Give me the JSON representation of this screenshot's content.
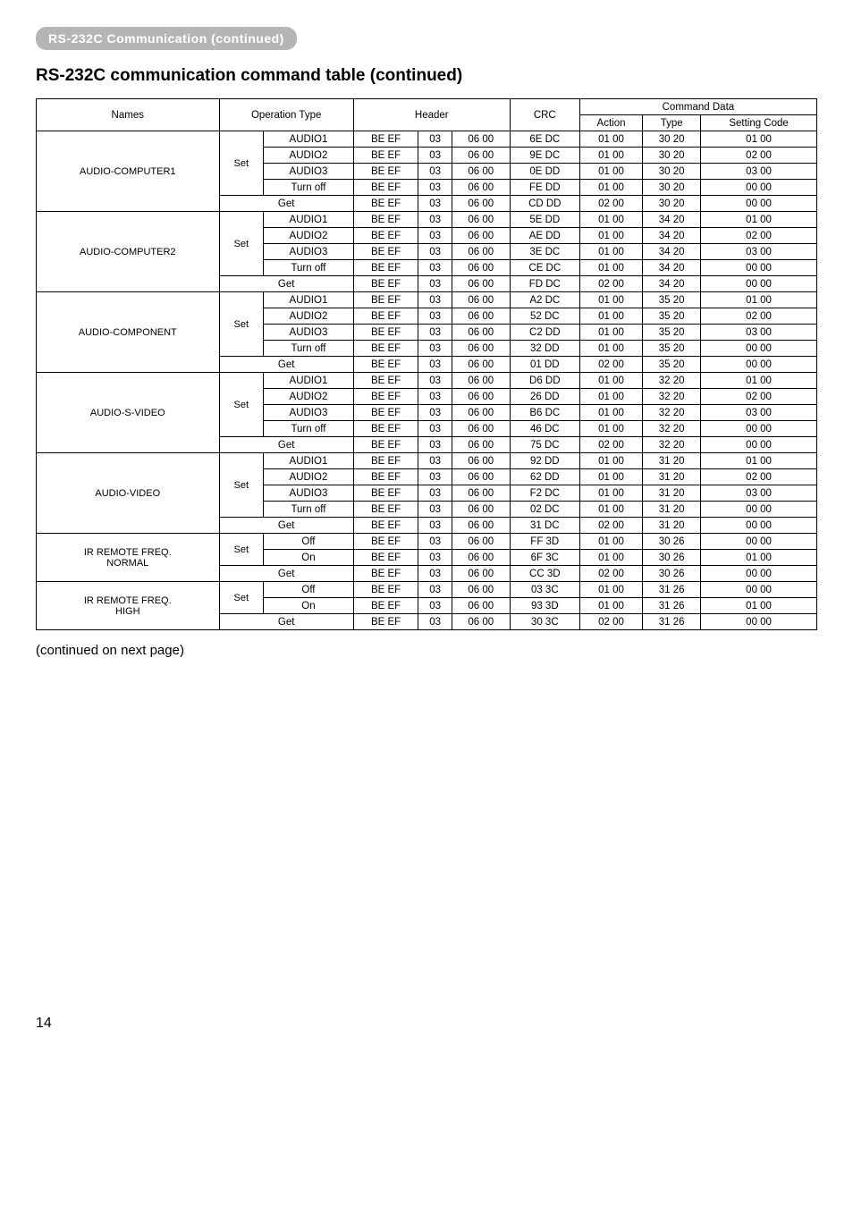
{
  "section_tab": "RS-232C Communication (continued)",
  "title": "RS-232C communication command table (continued)",
  "continued_note": "(continued on next page)",
  "page_num": "14",
  "headers": {
    "names": "Names",
    "operation_type": "Operation Type",
    "header": "Header",
    "crc": "CRC",
    "command_data": "Command Data",
    "action": "Action",
    "type": "Type",
    "setting_code": "Setting Code"
  },
  "groups": [
    {
      "name": "AUDIO-COMPUTER1",
      "set_label": "Set",
      "set_rows": [
        {
          "op": "AUDIO1",
          "h1": "BE  EF",
          "h2": "03",
          "h3": "06  00",
          "crc": "6E  DC",
          "act": "01  00",
          "typ": "30  20",
          "sc": "01  00"
        },
        {
          "op": "AUDIO2",
          "h1": "BE  EF",
          "h2": "03",
          "h3": "06  00",
          "crc": "9E  DC",
          "act": "01  00",
          "typ": "30  20",
          "sc": "02  00"
        },
        {
          "op": "AUDIO3",
          "h1": "BE  EF",
          "h2": "03",
          "h3": "06  00",
          "crc": "0E  DD",
          "act": "01  00",
          "typ": "30  20",
          "sc": "03  00"
        },
        {
          "op": "Turn off",
          "h1": "BE  EF",
          "h2": "03",
          "h3": "06  00",
          "crc": "FE  DD",
          "act": "01  00",
          "typ": "30  20",
          "sc": "00  00"
        }
      ],
      "get_row": {
        "op": "Get",
        "h1": "BE  EF",
        "h2": "03",
        "h3": "06  00",
        "crc": "CD  DD",
        "act": "02  00",
        "typ": "30  20",
        "sc": "00  00"
      }
    },
    {
      "name": "AUDIO-COMPUTER2",
      "set_label": "Set",
      "set_rows": [
        {
          "op": "AUDIO1",
          "h1": "BE  EF",
          "h2": "03",
          "h3": "06  00",
          "crc": "5E  DD",
          "act": "01  00",
          "typ": "34  20",
          "sc": "01  00"
        },
        {
          "op": "AUDIO2",
          "h1": "BE  EF",
          "h2": "03",
          "h3": "06  00",
          "crc": "AE  DD",
          "act": "01  00",
          "typ": "34  20",
          "sc": "02  00"
        },
        {
          "op": "AUDIO3",
          "h1": "BE  EF",
          "h2": "03",
          "h3": "06  00",
          "crc": "3E  DC",
          "act": "01  00",
          "typ": "34  20",
          "sc": "03  00"
        },
        {
          "op": "Turn off",
          "h1": "BE  EF",
          "h2": "03",
          "h3": "06  00",
          "crc": "CE  DC",
          "act": "01  00",
          "typ": "34  20",
          "sc": "00  00"
        }
      ],
      "get_row": {
        "op": "Get",
        "h1": "BE  EF",
        "h2": "03",
        "h3": "06  00",
        "crc": "FD  DC",
        "act": "02  00",
        "typ": "34  20",
        "sc": "00  00"
      }
    },
    {
      "name": "AUDIO-COMPONENT",
      "set_label": "Set",
      "set_rows": [
        {
          "op": "AUDIO1",
          "h1": "BE  EF",
          "h2": "03",
          "h3": "06  00",
          "crc": "A2  DC",
          "act": "01  00",
          "typ": "35  20",
          "sc": "01  00"
        },
        {
          "op": "AUDIO2",
          "h1": "BE  EF",
          "h2": "03",
          "h3": "06  00",
          "crc": "52  DC",
          "act": "01  00",
          "typ": "35  20",
          "sc": "02  00"
        },
        {
          "op": "AUDIO3",
          "h1": "BE  EF",
          "h2": "03",
          "h3": "06  00",
          "crc": "C2  DD",
          "act": "01  00",
          "typ": "35  20",
          "sc": "03  00"
        },
        {
          "op": "Turn off",
          "h1": "BE  EF",
          "h2": "03",
          "h3": "06  00",
          "crc": "32  DD",
          "act": "01  00",
          "typ": "35  20",
          "sc": "00  00"
        }
      ],
      "get_row": {
        "op": "Get",
        "h1": "BE  EF",
        "h2": "03",
        "h3": "06  00",
        "crc": "01  DD",
        "act": "02  00",
        "typ": "35  20",
        "sc": "00  00"
      }
    },
    {
      "name": "AUDIO-S-VIDEO",
      "set_label": "Set",
      "set_rows": [
        {
          "op": "AUDIO1",
          "h1": "BE  EF",
          "h2": "03",
          "h3": "06  00",
          "crc": "D6  DD",
          "act": "01  00",
          "typ": "32  20",
          "sc": "01  00"
        },
        {
          "op": "AUDIO2",
          "h1": "BE  EF",
          "h2": "03",
          "h3": "06  00",
          "crc": "26  DD",
          "act": "01  00",
          "typ": "32  20",
          "sc": "02  00"
        },
        {
          "op": "AUDIO3",
          "h1": "BE  EF",
          "h2": "03",
          "h3": "06  00",
          "crc": "B6  DC",
          "act": "01  00",
          "typ": "32  20",
          "sc": "03  00"
        },
        {
          "op": "Turn off",
          "h1": "BE  EF",
          "h2": "03",
          "h3": "06  00",
          "crc": "46  DC",
          "act": "01  00",
          "typ": "32  20",
          "sc": "00  00"
        }
      ],
      "get_row": {
        "op": "Get",
        "h1": "BE  EF",
        "h2": "03",
        "h3": "06  00",
        "crc": "75  DC",
        "act": "02  00",
        "typ": "32  20",
        "sc": "00  00"
      }
    },
    {
      "name": "AUDIO-VIDEO",
      "set_label": "Set",
      "set_rows": [
        {
          "op": "AUDIO1",
          "h1": "BE  EF",
          "h2": "03",
          "h3": "06  00",
          "crc": "92  DD",
          "act": "01  00",
          "typ": "31  20",
          "sc": "01  00"
        },
        {
          "op": "AUDIO2",
          "h1": "BE  EF",
          "h2": "03",
          "h3": "06  00",
          "crc": "62  DD",
          "act": "01  00",
          "typ": "31  20",
          "sc": "02  00"
        },
        {
          "op": "AUDIO3",
          "h1": "BE  EF",
          "h2": "03",
          "h3": "06  00",
          "crc": "F2  DC",
          "act": "01  00",
          "typ": "31  20",
          "sc": "03  00"
        },
        {
          "op": "Turn off",
          "h1": "BE  EF",
          "h2": "03",
          "h3": "06  00",
          "crc": "02  DC",
          "act": "01  00",
          "typ": "31  20",
          "sc": "00  00"
        }
      ],
      "get_row": {
        "op": "Get",
        "h1": "BE  EF",
        "h2": "03",
        "h3": "06  00",
        "crc": "31  DC",
        "act": "02  00",
        "typ": "31  20",
        "sc": "00  00"
      }
    },
    {
      "name": "IR REMOTE FREQ. NORMAL",
      "name_line1": "IR REMOTE FREQ.",
      "name_line2": "NORMAL",
      "set_label": "Set",
      "set_rows": [
        {
          "op": "Off",
          "h1": "BE  EF",
          "h2": "03",
          "h3": "06  00",
          "crc": "FF  3D",
          "act": "01  00",
          "typ": "30  26",
          "sc": "00  00"
        },
        {
          "op": "On",
          "h1": "BE  EF",
          "h2": "03",
          "h3": "06  00",
          "crc": "6F  3C",
          "act": "01  00",
          "typ": "30  26",
          "sc": "01  00"
        }
      ],
      "get_row": {
        "op": "Get",
        "h1": "BE  EF",
        "h2": "03",
        "h3": "06  00",
        "crc": "CC 3D",
        "act": "02  00",
        "typ": "30  26",
        "sc": "00  00"
      }
    },
    {
      "name": "IR REMOTE FREQ. HIGH",
      "name_line1": "IR REMOTE FREQ.",
      "name_line2": "HIGH",
      "set_label": "Set",
      "set_rows": [
        {
          "op": "Off",
          "h1": "BE  EF",
          "h2": "03",
          "h3": "06  00",
          "crc": "03  3C",
          "act": "01  00",
          "typ": "31  26",
          "sc": "00  00"
        },
        {
          "op": "On",
          "h1": "BE  EF",
          "h2": "03",
          "h3": "06  00",
          "crc": "93  3D",
          "act": "01  00",
          "typ": "31  26",
          "sc": "01  00"
        }
      ],
      "get_row": {
        "op": "Get",
        "h1": "BE  EF",
        "h2": "03",
        "h3": "06  00",
        "crc": "30  3C",
        "act": "02  00",
        "typ": "31  26",
        "sc": "00  00"
      }
    }
  ]
}
